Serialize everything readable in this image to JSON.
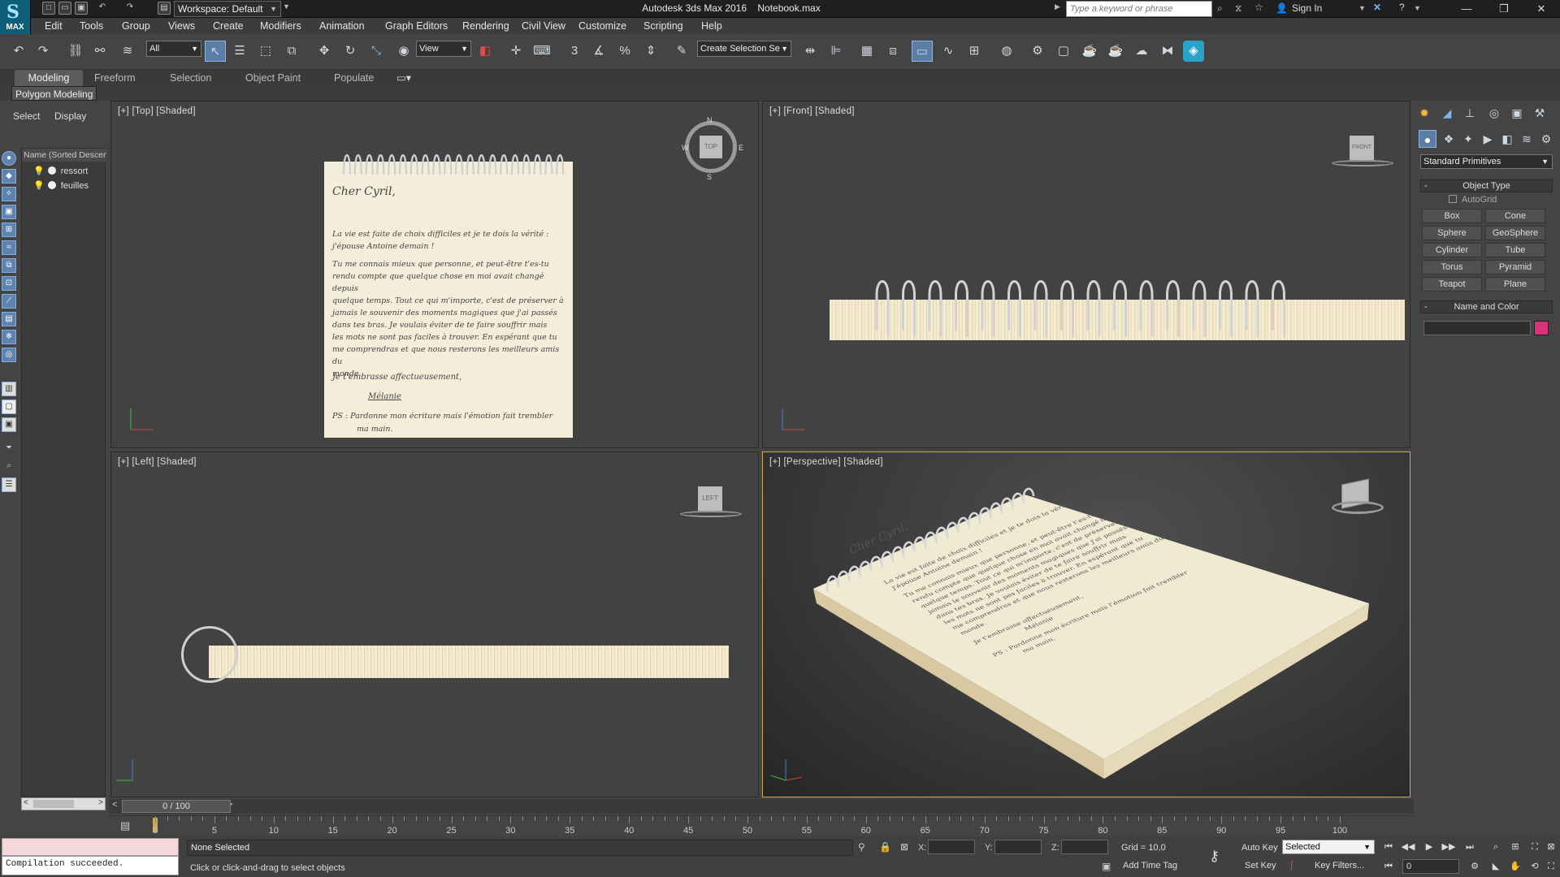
{
  "app": {
    "logo_label": "MAX",
    "workspace": "Workspace: Default",
    "title": "Autodesk 3ds Max 2016",
    "file": "Notebook.max",
    "search_placeholder": "Type a keyword or phrase",
    "sign_in": "Sign In"
  },
  "menu": [
    "Edit",
    "Tools",
    "Group",
    "Views",
    "Create",
    "Modifiers",
    "Animation",
    "Graph Editors",
    "Rendering",
    "Civil View",
    "Customize",
    "Scripting",
    "Help"
  ],
  "toolbar": {
    "filter": "All",
    "ref_coord": "View",
    "selection_set": "Create Selection Se"
  },
  "ribbon": {
    "tabs": [
      "Modeling",
      "Freeform",
      "Selection",
      "Object Paint",
      "Populate"
    ],
    "active_panel": "Polygon Modeling"
  },
  "scene_explorer": {
    "tabs": [
      "Select",
      "Display"
    ],
    "column_header": "Name (Sorted Descen",
    "items": [
      "ressort",
      "feuilles"
    ]
  },
  "viewports": {
    "top": "[+] [Top] [Shaded]",
    "front": "[+] [Front] [Shaded]",
    "left": "[+] [Left] [Shaded]",
    "perspective": "[+] [Perspective] [Shaded]",
    "viewcube_top": "TOP",
    "viewcube_front": "FRONT",
    "viewcube_left": "LEFT",
    "compass": {
      "n": "N",
      "s": "S",
      "e": "E",
      "w": "W"
    }
  },
  "letter": {
    "salutation": "Cher Cyril,",
    "lines": [
      "La vie est faite de choix difficiles et je te dois la vérité :",
      "j'épouse Antoine demain !",
      "Tu me connais mieux que personne, et peut-être t'es-tu",
      "rendu compte que quelque chose en moi avait changé depuis",
      "quelque temps. Tout ce qui m'importe, c'est de préserver à",
      "jamais le souvenir des moments magiques que j'ai passés",
      "dans tes bras. Je voulais éviter de te faire souffrir mais",
      "les mots ne sont pas faciles à trouver. En espérant que tu",
      "me comprendras et que nous resterons les meilleurs amis du",
      "monde."
    ],
    "closing": "Je t'embrasse affectueusement,",
    "signature": "Mélanie",
    "ps": "PS : Pardonne mon écriture mais l'émotion fait trembler",
    "ps2": "ma main."
  },
  "command_panel": {
    "dropdown": "Standard Primitives",
    "object_type_title": "Object Type",
    "autogrid": "AutoGrid",
    "buttons": [
      "Box",
      "Cone",
      "Sphere",
      "GeoSphere",
      "Cylinder",
      "Tube",
      "Torus",
      "Pyramid",
      "Teapot",
      "Plane"
    ],
    "name_color_title": "Name and Color",
    "color": "#d8327a"
  },
  "timeline": {
    "slider": "0 / 100",
    "ticks": [
      "0",
      "5",
      "10",
      "15",
      "20",
      "25",
      "30",
      "35",
      "40",
      "45",
      "50",
      "55",
      "60",
      "65",
      "70",
      "75",
      "80",
      "85",
      "90",
      "95",
      "100"
    ]
  },
  "status": {
    "script_output": "Compilation succeeded.",
    "selection": "None Selected",
    "prompt": "Click or click-and-drag to select objects",
    "x_label": "X:",
    "y_label": "Y:",
    "z_label": "Z:",
    "grid": "Grid = 10,0",
    "add_time_tag": "Add Time Tag",
    "auto_key": "Auto Key",
    "set_key": "Set Key",
    "key_mode": "Selected",
    "key_filters": "Key Filters...",
    "frame": "0"
  }
}
